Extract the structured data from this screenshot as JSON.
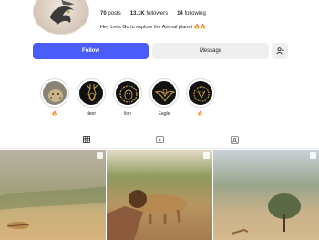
{
  "profile": {
    "stats": {
      "posts_count": "70",
      "posts_label": "posts",
      "followers_count": "13.1K",
      "followers_label": "followers",
      "following_count": "14",
      "following_label": "following"
    },
    "bio": "Hey Let's Go to explore the Animal planet 🔥🔥"
  },
  "actions": {
    "follow_label": "Follow",
    "message_label": "Message",
    "suggest_icon": "add-person-icon"
  },
  "highlights": [
    {
      "label": "🔥",
      "icon": "leopard-photo"
    },
    {
      "label": "deer",
      "icon": "deer-gold-art"
    },
    {
      "label": "lion",
      "icon": "lion-gold-art"
    },
    {
      "label": "Eagle",
      "icon": "eagle-gold-art"
    },
    {
      "label": "🔥",
      "icon": "beast-gold-art"
    }
  ],
  "tabs": [
    {
      "name": "posts",
      "icon": "grid-icon",
      "active": true
    },
    {
      "name": "reels",
      "icon": "reels-icon",
      "active": false
    },
    {
      "name": "tagged",
      "icon": "tagged-icon",
      "active": false
    }
  ],
  "colors": {
    "accent": "#4a5df9",
    "secondary_button": "#efefef",
    "text": "#262626"
  }
}
